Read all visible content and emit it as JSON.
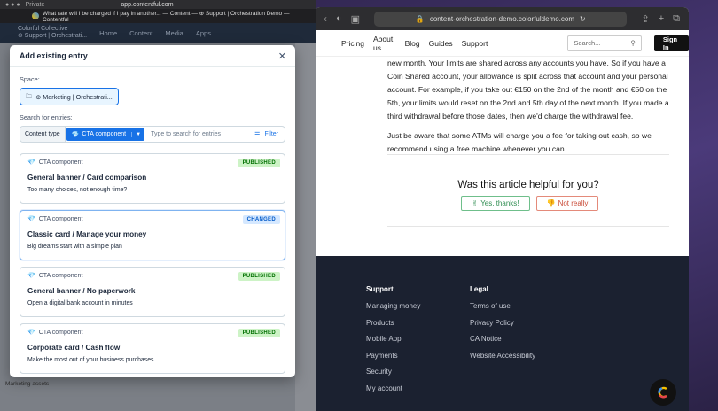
{
  "right_browser": {
    "url": "content-orchestration-demo.colorfuldemo.com",
    "site_nav": [
      "Pricing",
      "About us",
      "Blog",
      "Guides",
      "Support"
    ],
    "search_placeholder": "Search...",
    "signin_label": "Sign In",
    "article_paragraphs": [
      "new month. Your limits are shared across any accounts you have. So if you have a Coin Shared account, your allowance is split across that account and your personal account. For example, if you take out €150 on the 2nd of the month and €50 on the 5th, your limits would reset on the 2nd and 5th day of the next month. If you made a third withdrawal before those dates, then we'd charge the withdrawal fee.",
      "Just be aware that some ATMs will charge you a fee for taking out cash, so we recommend using a free machine whenever you can."
    ],
    "helpful_question": "Was this article helpful for you?",
    "yes_label": "Yes, thanks!",
    "no_label": "Not really",
    "footer": {
      "support_title": "Support",
      "support_links": [
        "Managing money",
        "Products",
        "Mobile App",
        "Payments",
        "Security",
        "My account"
      ],
      "legal_title": "Legal",
      "legal_links": [
        "Terms of use",
        "Privacy Policy",
        "CA Notice",
        "Website Accessibility"
      ]
    }
  },
  "left_browser": {
    "private_label": "Private",
    "url": "app.contentful.com",
    "tab_title": "What rate will I be charged if I pay in another... — Content — ⊕ Support | Orchestration Demo — Contentful",
    "org_name": "Colorful Collective",
    "space_name": "⊕ Support | Orchestrati...",
    "nav": [
      "Home",
      "Content",
      "Media",
      "Apps"
    ],
    "background_footer": "Marketing assets"
  },
  "modal": {
    "title": "Add existing entry",
    "space_label": "Space:",
    "space_value": "⊕ Marketing | Orchestrati...",
    "search_label": "Search for entries:",
    "content_type_label": "Content type",
    "content_type_value": "CTA component",
    "search_placeholder": "Type to search for entries",
    "filter_label": "Filter",
    "entries": [
      {
        "type": "CTA component",
        "status": "PUBLISHED",
        "title": "General banner / Card comparison",
        "description": "Too many choices, not enough time?"
      },
      {
        "type": "CTA component",
        "status": "CHANGED",
        "title": "Classic card / Manage your money",
        "description": "Big dreams start with a simple plan"
      },
      {
        "type": "CTA component",
        "status": "PUBLISHED",
        "title": "General banner / No paperwork",
        "description": "Open a digital bank account in minutes"
      },
      {
        "type": "CTA component",
        "status": "PUBLISHED",
        "title": "Corporate card / Cash flow",
        "description": "Make the most out of your business purchases"
      }
    ]
  },
  "colors": {
    "accent": "#1872e6",
    "published_bg": "#cdf3c6",
    "changed_bg": "#d5e8ff",
    "footer_bg": "#1b2130"
  }
}
